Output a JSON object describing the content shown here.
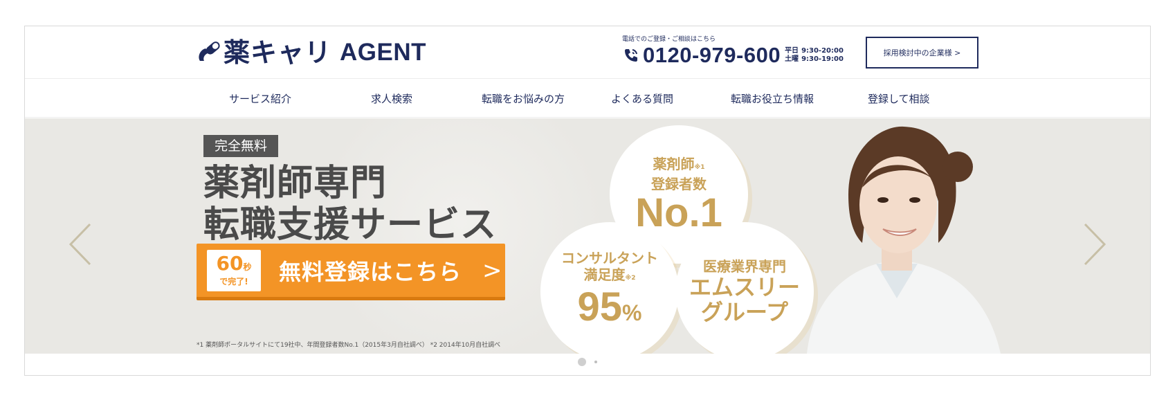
{
  "header": {
    "logo_jp": "薬キャリ",
    "logo_en": "AGENT",
    "tel_caption": "電話でのご登録・ご相談はこちら",
    "tel_number": "0120-979-600",
    "hours": [
      {
        "day": "平日",
        "time": "9:30-20:00"
      },
      {
        "day": "土曜",
        "time": "9:30-19:00"
      }
    ],
    "corporate_button": "採用検討中の企業様 >"
  },
  "nav": {
    "items": [
      "サービス紹介",
      "求人検索",
      "転職をお悩みの方",
      "よくある質問",
      "転職お役立ち情報",
      "登録して相談"
    ]
  },
  "hero": {
    "badge": "完全無料",
    "headline_line1": "薬剤師専門",
    "headline_line2": "転職支援サービス",
    "cta": {
      "seconds": "60",
      "seconds_unit": "秒",
      "seconds_sub": "で完了!",
      "label": "無料登録はこちら",
      "arrow": ">"
    },
    "circle1": {
      "title_line1": "薬剤師",
      "note": "※1",
      "title_line2": "登録者数",
      "value": "No.1"
    },
    "circle2": {
      "title_line1": "コンサルタント",
      "title_line2": "満足度",
      "note": "※2",
      "value": "95",
      "unit": "%"
    },
    "circle3": {
      "title_line1": "医療業界専門",
      "value_line1": "エムスリー",
      "value_line2": "グループ"
    },
    "footnote": "*1 薬剤師ポータルサイトにて19社中、年間登録者数No.1（2015年3月自社調べ） *2 2014年10月自社調べ"
  },
  "carousel": {
    "slides": 2,
    "active_slide": 1
  },
  "colors": {
    "brand_navy": "#1e2a5c",
    "cta_orange": "#f39426",
    "gold": "#c9a258",
    "hero_bg": "#e9e8e4"
  }
}
